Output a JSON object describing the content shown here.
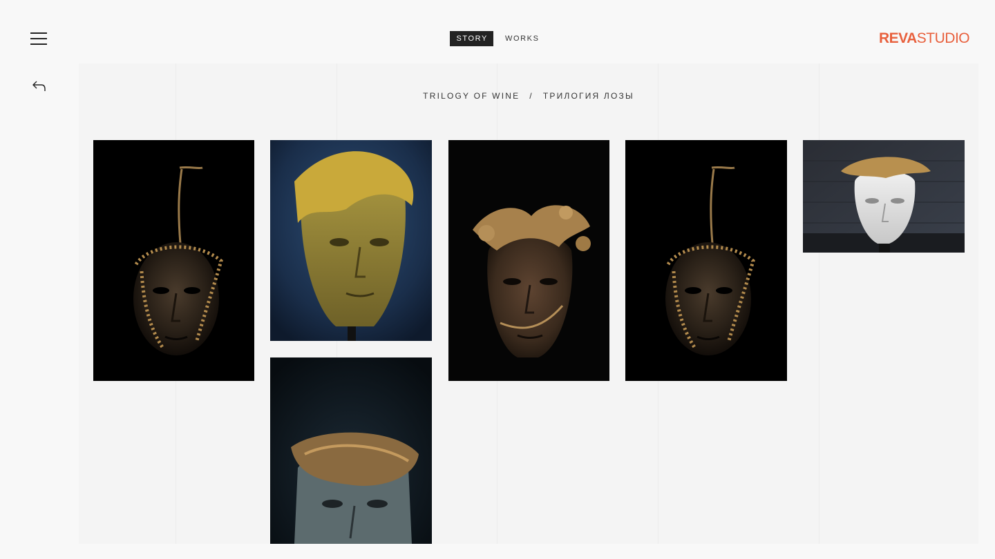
{
  "nav": {
    "tabs": [
      {
        "label": "STORY",
        "active": true
      },
      {
        "label": "WORKS",
        "active": false
      }
    ]
  },
  "logo": {
    "bold": "REVA",
    "light": "STUDIO",
    "color": "#e8603d"
  },
  "breadcrumb": {
    "items": [
      "TRILOGY OF WINE",
      "ТРИЛОГИЯ ЛОЗЫ"
    ],
    "separator": "/"
  },
  "icons": {
    "menu": "hamburger-menu-icon",
    "back": "back-arrow-icon"
  },
  "gallery": [
    {
      "name": "photo-bronze-mask-vine-1",
      "subject": "bronze mask with golden vine on black"
    },
    {
      "name": "photo-gold-mask-blue",
      "subject": "golden mask with leaf crown on blue"
    },
    {
      "name": "photo-bronze-mask-grape-leaves",
      "subject": "bronze mask with grape leaves"
    },
    {
      "name": "photo-bronze-mask-vine-2",
      "subject": "bronze mask with golden vine on black"
    },
    {
      "name": "photo-white-mask-vine",
      "subject": "white mask with golden vine on brick"
    },
    {
      "name": "photo-bronze-mask-band",
      "subject": "bronze mask with wrapped band"
    }
  ]
}
